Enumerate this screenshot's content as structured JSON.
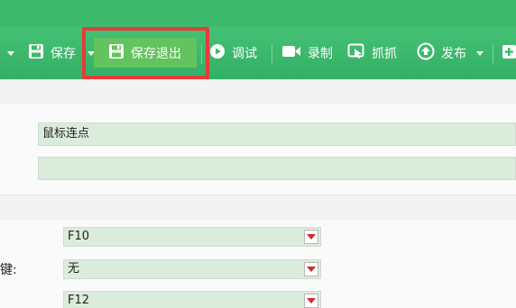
{
  "toolbar": {
    "save": "保存",
    "save_exit": "保存退出",
    "debug": "调试",
    "record": "录制",
    "capture": "抓抓",
    "publish": "发布"
  },
  "form": {
    "name_value": "鼠标连点",
    "second_value": ""
  },
  "hotkeys": {
    "row1_value": "F10",
    "row2_label": "键:",
    "row2_value": "无",
    "row3_value": "F12"
  },
  "colors": {
    "toolbar_green": "#3cb96d",
    "highlight_red": "#e63b3b",
    "field_green": "#dcecdc"
  }
}
